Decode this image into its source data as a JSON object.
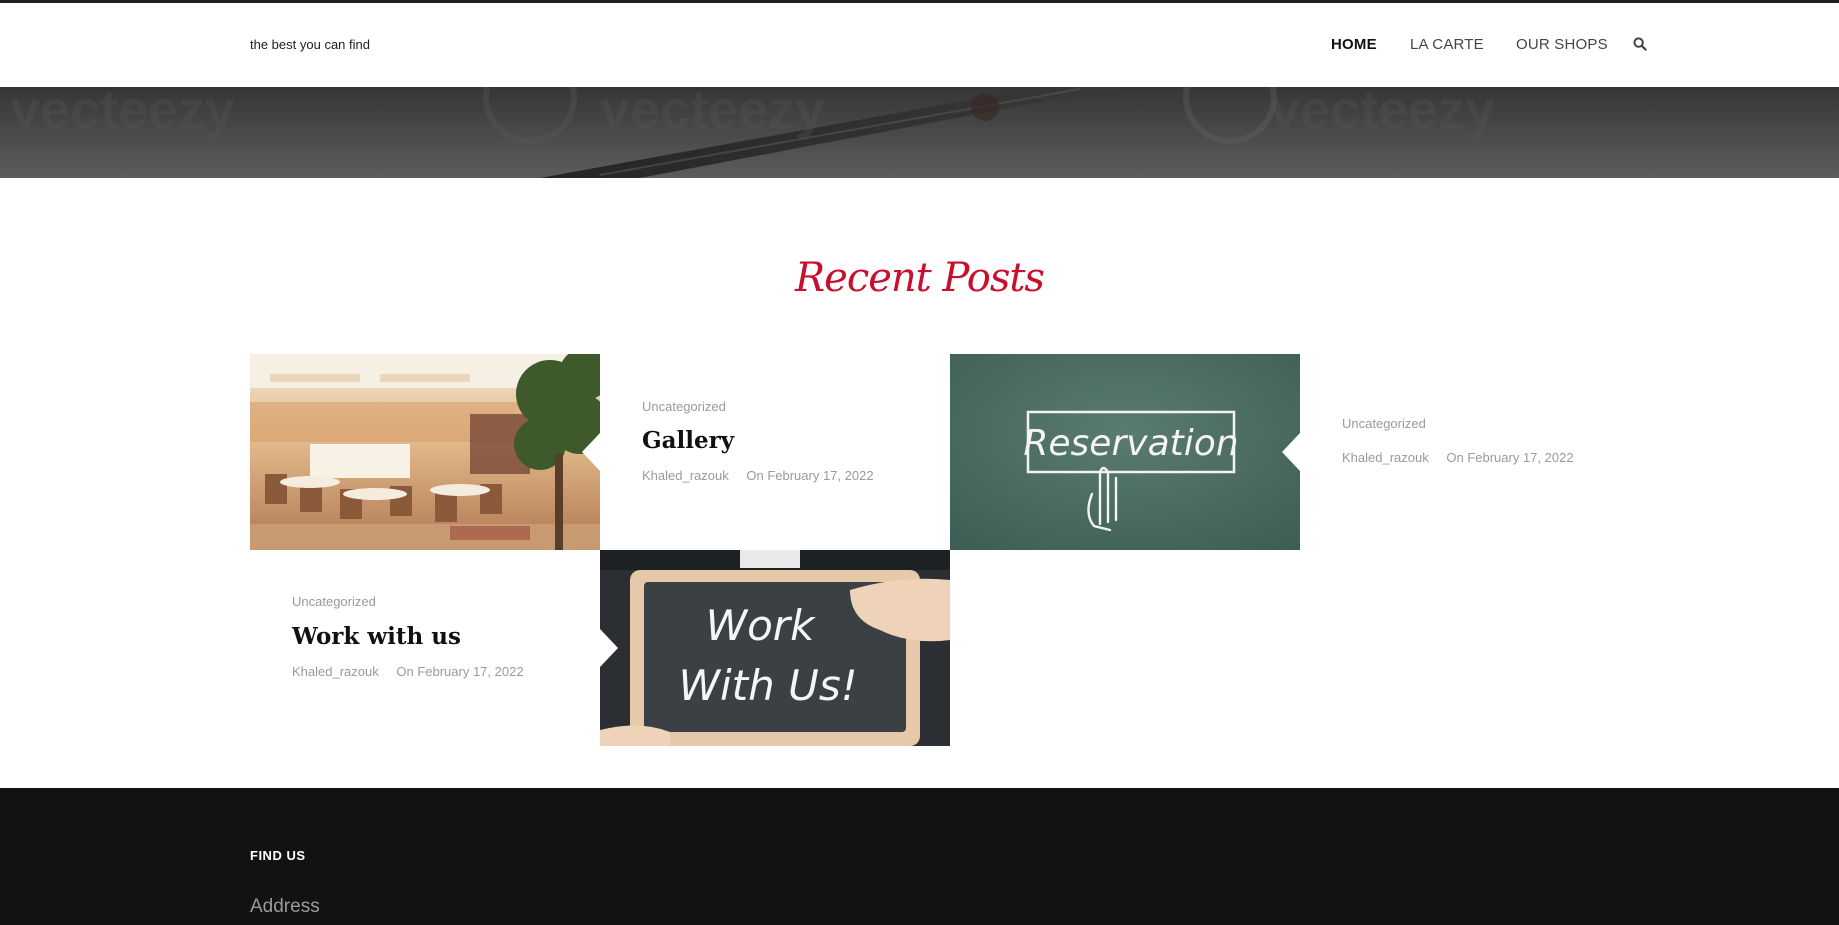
{
  "header": {
    "tagline": "the best you can find",
    "nav": [
      {
        "label": "HOME",
        "active": true
      },
      {
        "label": "LA CARTE",
        "active": false
      },
      {
        "label": "OUR SHOPS",
        "active": false
      }
    ],
    "search_icon": "search-icon"
  },
  "hero": {
    "watermark_text": "vecteezy"
  },
  "recent_posts": {
    "title": "Recent Posts",
    "posts": [
      {
        "image": "restaurant-dining-room",
        "category": "Uncategorized",
        "title": "Gallery",
        "author": "Khaled_razouk",
        "date": "On February 17, 2022"
      },
      {
        "image": "chalkboard-reservation",
        "image_text": "Reservation",
        "category": "Uncategorized",
        "title": "",
        "author": "Khaled_razouk",
        "date": "On February 17, 2022"
      },
      {
        "image": "chalkboard-work-with-us",
        "image_text_line1": "Work",
        "image_text_line2": "With Us!",
        "category": "Uncategorized",
        "title": "Work with us",
        "author": "Khaled_razouk",
        "date": "On February 17, 2022"
      }
    ]
  },
  "footer": {
    "heading": "FIND US",
    "address_label": "Address"
  },
  "colors": {
    "accent": "#c8102e",
    "footer_bg": "#121212",
    "meta_gray": "#9a9a9a",
    "chalkboard_green": "#4a6b62"
  }
}
